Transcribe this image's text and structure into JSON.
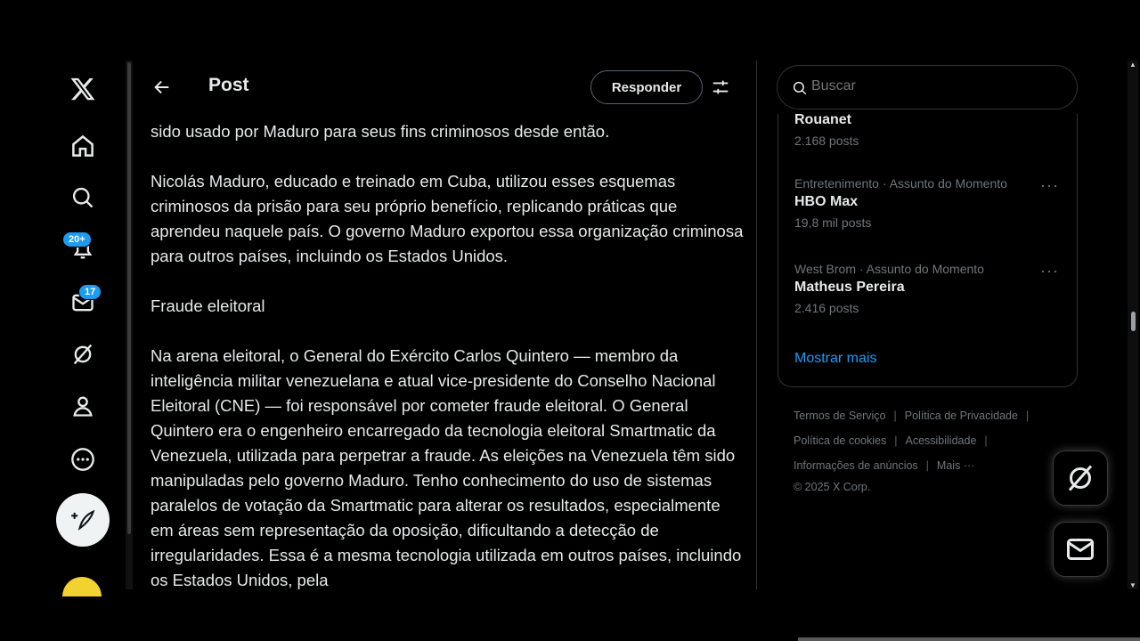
{
  "app": {
    "name": "X",
    "accent": "#1d9bf0"
  },
  "nav": {
    "items": [
      {
        "name": "home-icon"
      },
      {
        "name": "search-icon"
      },
      {
        "name": "bell-icon",
        "badge": "20+"
      },
      {
        "name": "mail-icon",
        "badge": "17"
      },
      {
        "name": "grok-icon"
      },
      {
        "name": "profile-icon"
      },
      {
        "name": "more-icon"
      }
    ],
    "post_icon": "feather-plus-icon"
  },
  "header": {
    "title": "Post",
    "reply_label": "Responder"
  },
  "post": {
    "partial_line": "sido usado por Maduro para seus fins criminosos desde então.",
    "para2": "Nicolás Maduro, educado e treinado em Cuba, utilizou esses esquemas criminosos da prisão para seu próprio benefício, replicando práticas que aprendeu naquele país. O governo Maduro exportou essa organização criminosa para outros países, incluindo os Estados Unidos.",
    "heading": "Fraude eleitoral",
    "para4": "Na arena eleitoral, o General do Exército Carlos Quintero — membro da inteligência militar venezuelana e atual vice-presidente do Conselho Nacional Eleitoral (CNE) — foi responsável por cometer fraude eleitoral. O General Quintero era o engenheiro encarregado da tecnologia eleitoral Smartmatic da Venezuela, utilizada para perpetrar a fraude. As eleições na Venezuela têm sido manipuladas pelo governo Maduro. Tenho conhecimento do uso de sistemas paralelos de votação da Smartmatic para alterar os resultados, especialmente em áreas sem representação da oposição, dificultando a detecção de irregularidades. Essa é a mesma tecnologia utilizada em outros países, incluindo os Estados Unidos, pela"
  },
  "search": {
    "placeholder": "Buscar"
  },
  "trends": [
    {
      "context": "",
      "name": "Rouanet",
      "count": "2.168 posts"
    },
    {
      "context": "Entretenimento · Assunto do Momento",
      "name": "HBO Max",
      "count": "19,8 mil posts"
    },
    {
      "context": "West Brom · Assunto do Momento",
      "name": "Matheus Pereira",
      "count": "2.416 posts"
    }
  ],
  "trends_more_glyph": "···",
  "show_more": "Mostrar mais",
  "footer": {
    "terms": "Termos de Serviço",
    "privacy": "Política de Privacidade",
    "cookies": "Política de cookies",
    "accessibility": "Acessibilidade",
    "ads": "Informações de anúncios",
    "more": "Mais ···",
    "copyright": "© 2025 X Corp."
  }
}
